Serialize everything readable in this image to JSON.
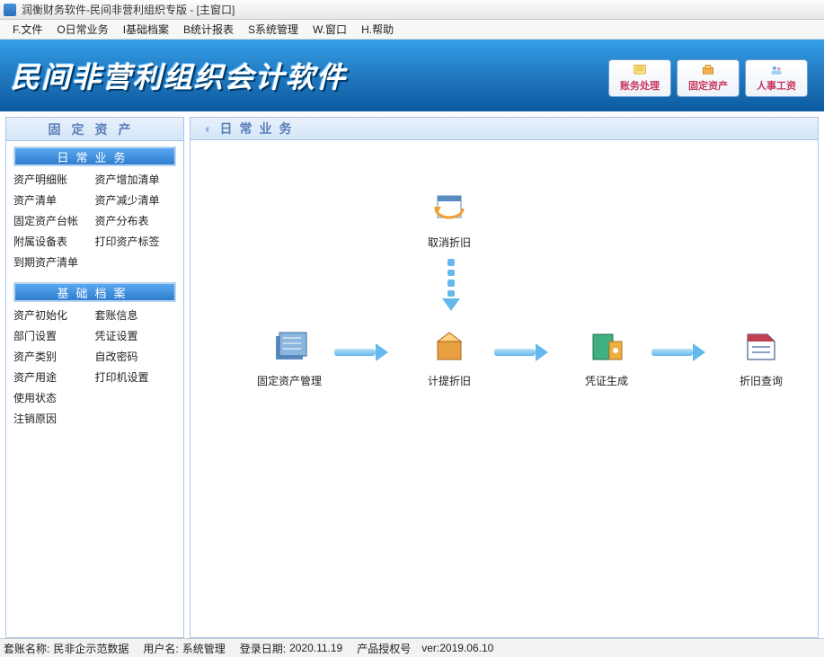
{
  "window": {
    "title": "润衡财务软件-民间非营利组织专版 - [主窗口]"
  },
  "menu": {
    "file": "F.文件",
    "ops": "O日常业务",
    "archive": "I基础档案",
    "report": "B统计报表",
    "sys": "S系统管理",
    "window": "W.窗口",
    "help": "H.帮助"
  },
  "banner": {
    "title": "民间非营利组织会计软件",
    "btn1": "账务处理",
    "btn2": "固定资产",
    "btn3": "人事工资"
  },
  "sidebar": {
    "title": "固定资产",
    "section1": {
      "label": "日常业务",
      "i0": "资产明细账",
      "i1": "资产增加清单",
      "i2": "资产清单",
      "i3": "资产减少清单",
      "i4": "固定资产台帐",
      "i5": "资产分布表",
      "i6": "附属设备表",
      "i7": "打印资产标签",
      "i8": "到期资产清单"
    },
    "section2": {
      "label": "基础档案",
      "i0": "资产初始化",
      "i1": "套账信息",
      "i2": "部门设置",
      "i3": "凭证设置",
      "i4": "资产类别",
      "i5": "自改密码",
      "i6": "资产用途",
      "i7": "打印机设置",
      "i8": "使用状态",
      "i9": "注销原因"
    }
  },
  "main": {
    "title": "日常业务",
    "nodes": {
      "cancel": "取消折旧",
      "asset_mgmt": "固定资产管理",
      "calc_dep": "计提折旧",
      "voucher": "凭证生成",
      "query": "折旧查询"
    }
  },
  "status": {
    "account_label": "套账名称:",
    "account_value": "民非企示范数据",
    "user_label": "用户名:",
    "user_value": "系统管理",
    "login_label": "登录日期:",
    "login_value": "2020.11.19",
    "auth_label": "产品授权号",
    "auth_value": "ver:2019.06.10"
  }
}
